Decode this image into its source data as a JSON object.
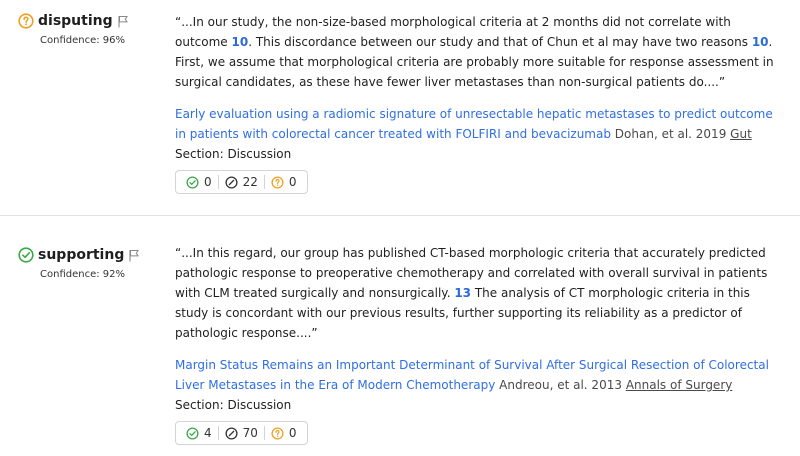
{
  "citations": [
    {
      "type": "disputing",
      "type_icon": "question-circle-icon",
      "type_color": "#f0a020",
      "confidence": "Confidence: 96%",
      "quote_parts": [
        "“...In our study, the non-size-based morphological criteria at 2 months did not correlate with outcome ",
        "10",
        ". This discordance between our study and that of Chun et al may have two reasons ",
        "10",
        ". First, we assume that morphological criteria are probably more suitable for response assessment in surgical candidates, as these have fewer liver metastases than non-surgical patients do....”"
      ],
      "paper_title": "Early evaluation using a radiomic signature of unresectable hepatic metastases to predict outcome in patients with colorectal cancer treated with FOLFIRI and bevacizumab",
      "authors_year": "Dohan, et al. 2019",
      "journal": "Gut",
      "section": "Section: Discussion",
      "tally": {
        "supporting": "0",
        "mentioning": "22",
        "disputing": "0"
      }
    },
    {
      "type": "supporting",
      "type_icon": "check-circle-icon",
      "type_color": "#3aa84a",
      "confidence": "Confidence: 92%",
      "quote_parts": [
        "“...In this regard, our group has published CT-based morphologic criteria that accurately predicted pathologic response to preoperative chemotherapy and correlated with overall survival in patients with CLM treated surgically and nonsurgically. ",
        "13",
        " The analysis of CT morphologic criteria in this study is concordant with our previous results, further supporting its reliability as a predictor of pathologic response....”"
      ],
      "paper_title": "Margin Status Remains an Important Determinant of Survival After Surgical Resection of Colorectal Liver Metastases in the Era of Modern Chemotherapy",
      "authors_year": "Andreou, et al. 2013",
      "journal": "Annals of Surgery",
      "section": "Section: Discussion",
      "tally": {
        "supporting": "4",
        "mentioning": "70",
        "disputing": "0"
      }
    }
  ],
  "colors": {
    "supporting": "#3aa84a",
    "mentioning": "#333333",
    "disputing": "#f0a020",
    "link": "#2f6fe0"
  }
}
